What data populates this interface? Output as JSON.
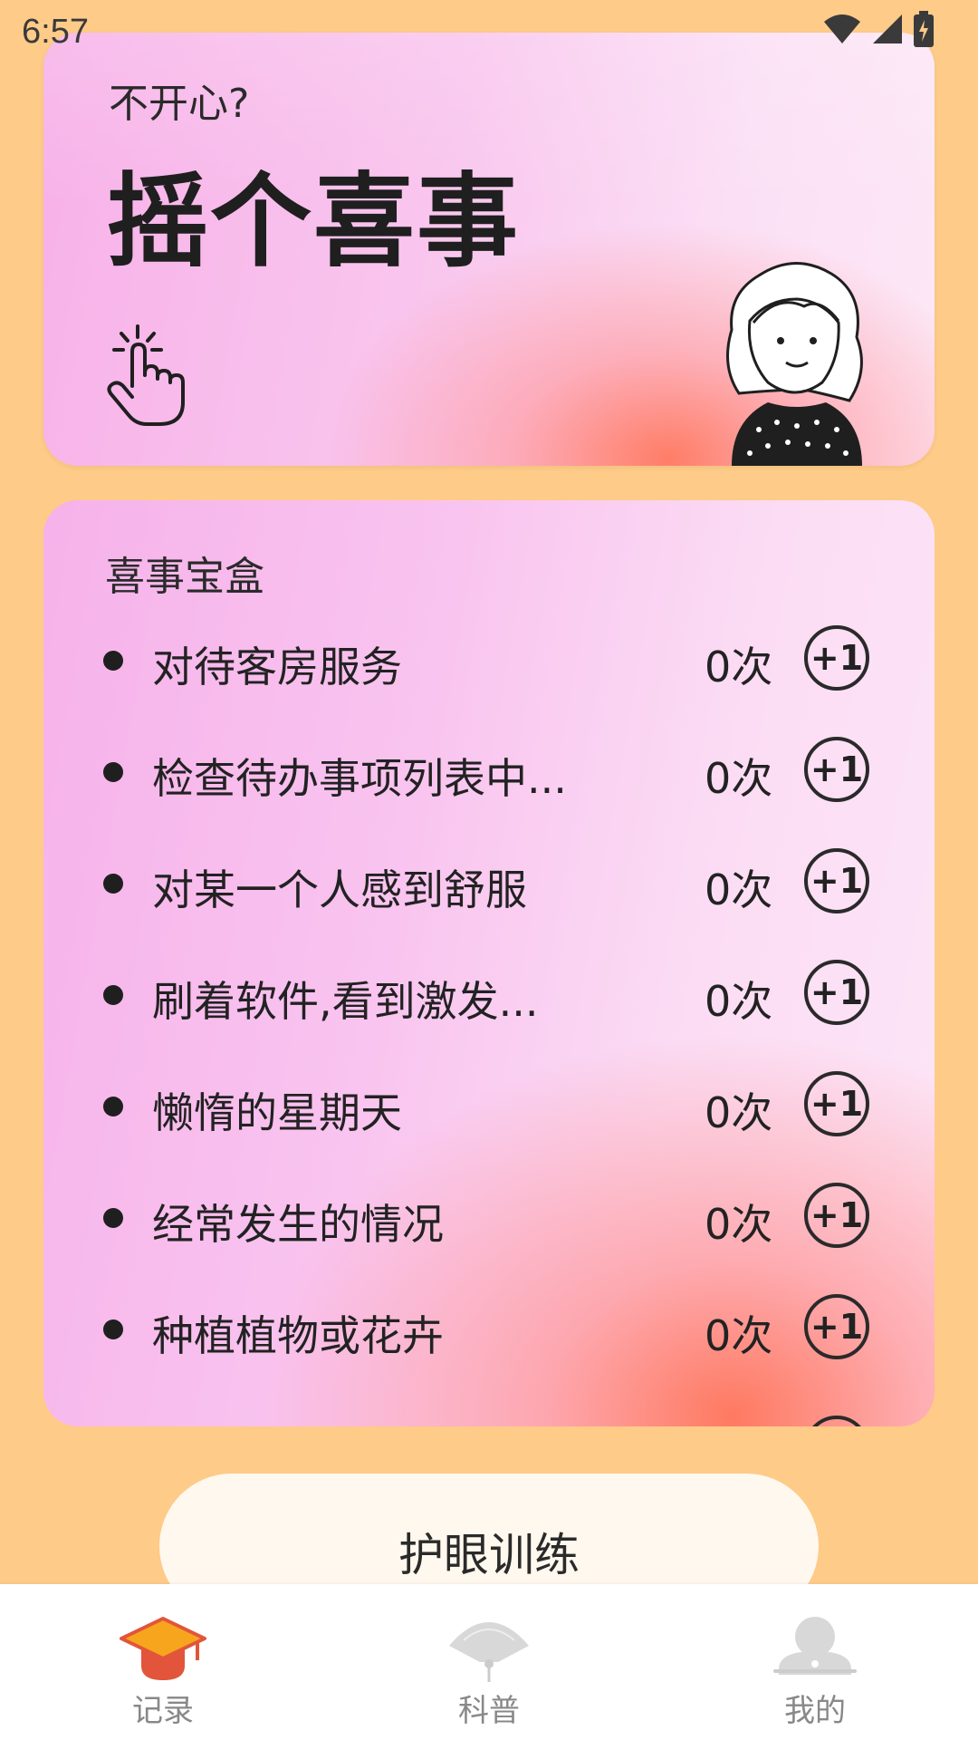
{
  "status_bar": {
    "time": "6:57",
    "icons": [
      "wifi-icon",
      "signal-icon",
      "battery-charging-icon"
    ]
  },
  "top_card": {
    "subtitle": "不开心?",
    "title": "摇个喜事",
    "icons": [
      "shake-hand-icon",
      "girl-illustration"
    ]
  },
  "joy_box": {
    "title": "喜事宝盒",
    "items": [
      {
        "label": "对待客房服务",
        "count": "0次",
        "action": "+1"
      },
      {
        "label": "检查待办事项列表中...",
        "count": "0次",
        "action": "+1"
      },
      {
        "label": "对某一个人感到舒服",
        "count": "0次",
        "action": "+1"
      },
      {
        "label": "刷着软件,看到激发...",
        "count": "0次",
        "action": "+1"
      },
      {
        "label": "懒惰的星期天",
        "count": "0次",
        "action": "+1"
      },
      {
        "label": "经常发生的情况",
        "count": "0次",
        "action": "+1"
      },
      {
        "label": "种植植物或花卉",
        "count": "0次",
        "action": "+1"
      }
    ]
  },
  "eye_training": {
    "label": "护眼训练"
  },
  "bottom_nav": {
    "items": [
      {
        "label": "记录",
        "icon": "graduation-cap-icon",
        "active": true
      },
      {
        "label": "科普",
        "icon": "fan-icon",
        "active": false
      },
      {
        "label": "我的",
        "icon": "profile-icon",
        "active": false
      }
    ]
  },
  "colors": {
    "background": "#fecb88",
    "card_pink": "#f7b1e8",
    "card_coral": "#ff785f",
    "button_bg": "#fff8ee",
    "nav_active": "#e2553b",
    "nav_inactive": "#cccccc"
  }
}
